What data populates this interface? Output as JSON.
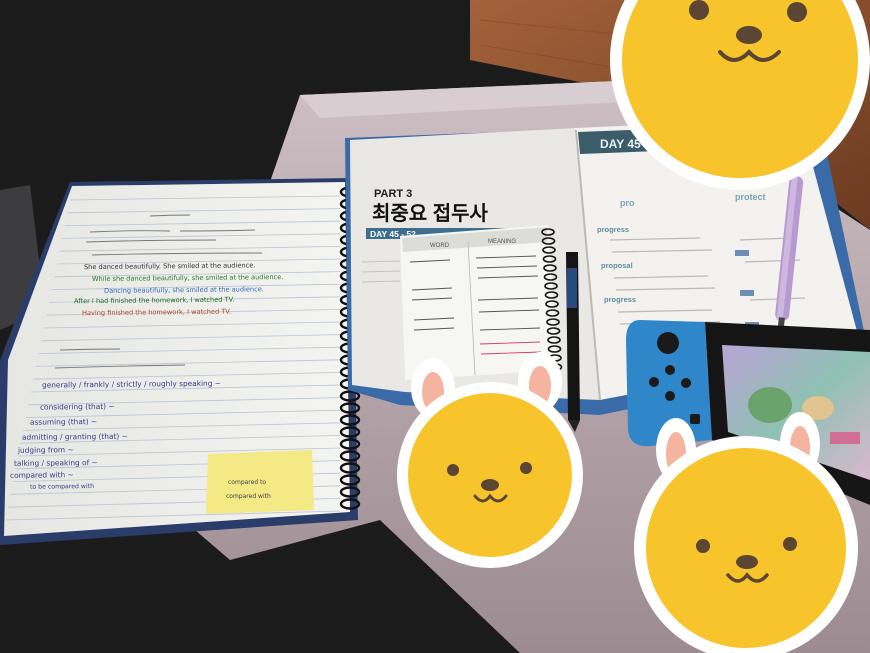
{
  "notebook": {
    "lines": [
      "She danced beautifully. She smiled at the audience.",
      "While she danced beautifully, she smiled at the audience.",
      "Dancing beautifully, she smiled at the audience.",
      "After I had finished the homework, I watched TV.",
      "Having finished the homework, I watched TV.",
      "generally / frankly / strictly / roughly speaking ~",
      "considering (that) ~",
      "assuming (that) ~",
      "admitting / granting (that) ~",
      "judging from ~",
      "talking / speaking of ~",
      "compared with ~",
      "to be compared with"
    ],
    "sticky_note": [
      "compared to",
      "compared with"
    ]
  },
  "textbook": {
    "part": "PART 3",
    "title": "최중요 접두사",
    "day_range": "DAY 45 - 52",
    "day_label": "DAY 45",
    "words": [
      "pro",
      "protect",
      "progress",
      "proposal",
      "progress"
    ]
  },
  "mini_notebook": {
    "columns": [
      "WORD",
      "MEANING"
    ]
  },
  "colors": {
    "floor": "#8a4f2c",
    "tray": "#b9a9ae",
    "sticker_face": "#f7c52b",
    "ear_pink": "#f4b4a0",
    "joycon_blue": "#2f86c9"
  },
  "stickers": [
    "bear-sticker",
    "bunny-sticker",
    "bunny-sticker",
    "bear-sticker"
  ]
}
